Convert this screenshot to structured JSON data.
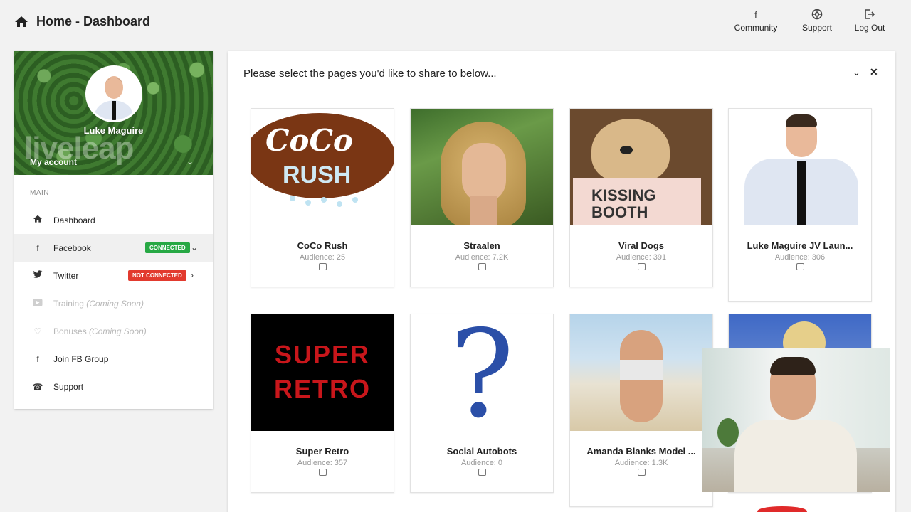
{
  "header": {
    "title": "Home - Dashboard",
    "nav": {
      "community": "Community",
      "support": "Support",
      "logout": "Log Out"
    }
  },
  "sidebar": {
    "profile": {
      "name": "Luke Maguire",
      "brand": "liveleap",
      "account_label": "My account"
    },
    "section_label": "MAIN",
    "items": [
      {
        "label": "Dashboard",
        "icon": "home-icon"
      },
      {
        "label": "Facebook",
        "icon": "facebook-icon",
        "badge": "CONNECTED"
      },
      {
        "label": "Twitter",
        "icon": "twitter-icon",
        "badge": "NOT CONNECTED"
      },
      {
        "label": "Training",
        "suffix": "(Coming Soon)",
        "icon": "video-icon"
      },
      {
        "label": "Bonuses",
        "suffix": "(Coming Soon)",
        "icon": "heart-icon"
      },
      {
        "label": "Join FB Group",
        "icon": "facebook-icon"
      },
      {
        "label": "Support",
        "icon": "phone-icon"
      }
    ]
  },
  "panel": {
    "prompt": "Please select the pages you'd like to share to below...",
    "pages": [
      {
        "name": "CoCo Rush",
        "audience": "Audience: 25",
        "logo_text": "CoCo Rush"
      },
      {
        "name": "Straalen",
        "audience": "Audience: 7.2K"
      },
      {
        "name": "Viral Dogs",
        "audience": "Audience: 391",
        "sign_text": "KISSING BOOTH"
      },
      {
        "name": "Luke Maguire JV Laun...",
        "audience": "Audience: 306"
      },
      {
        "name": "Super Retro",
        "audience": "Audience: 357",
        "logo_line1": "SUPER",
        "logo_line2": "RETRO"
      },
      {
        "name": "Social Autobots",
        "audience": "Audience: 0"
      },
      {
        "name": "Amanda Blanks Model ...",
        "audience": "Audience: 1.3K"
      }
    ]
  },
  "colors": {
    "connected": "#27a844",
    "not_connected": "#e23a2e",
    "background": "#f2f2f2"
  }
}
